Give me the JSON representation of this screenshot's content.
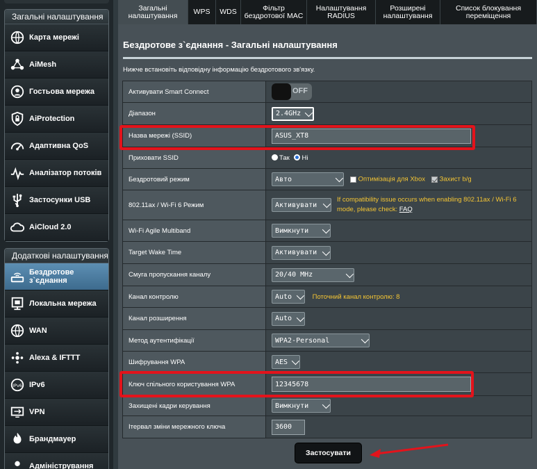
{
  "sidebar": {
    "general_title": "Загальні налаштування",
    "general_items": [
      {
        "label": "Карта мережі",
        "icon": "network-map-icon"
      },
      {
        "label": "AiMesh",
        "icon": "aimesh-icon"
      },
      {
        "label": "Гостьова мережа",
        "icon": "guest-network-icon"
      },
      {
        "label": "AiProtection",
        "icon": "shield-lock-icon"
      },
      {
        "label": "Адаптивна QoS",
        "icon": "qos-gauge-icon"
      },
      {
        "label": "Аналізатор потоків",
        "icon": "traffic-analyzer-icon"
      },
      {
        "label": "Застосунки USB",
        "icon": "usb-icon"
      },
      {
        "label": "AiCloud 2.0",
        "icon": "cloud-icon"
      }
    ],
    "advanced_title": "Додаткові налаштування",
    "advanced_items": [
      {
        "label": "Бездротове з`єднання",
        "icon": "wireless-icon"
      },
      {
        "label": "Локальна мережа",
        "icon": "lan-icon"
      },
      {
        "label": "WAN",
        "icon": "globe-icon"
      },
      {
        "label": "Alexa & IFTTT",
        "icon": "alexa-ifttt-icon"
      },
      {
        "label": "IPv6",
        "icon": "ipv6-icon"
      },
      {
        "label": "VPN",
        "icon": "vpn-icon"
      },
      {
        "label": "Брандмауер",
        "icon": "firewall-icon"
      },
      {
        "label": "Адміністрування",
        "icon": "admin-icon"
      }
    ]
  },
  "tabs": [
    {
      "label": "Загальні налаштування"
    },
    {
      "label": "WPS"
    },
    {
      "label": "WDS"
    },
    {
      "label": "Фільтр бездротової MAC"
    },
    {
      "label": "Налаштування RADIUS"
    },
    {
      "label": "Розширені налаштування"
    },
    {
      "label": "Список блокування переміщення"
    }
  ],
  "page": {
    "title": "Бездротове з`єднання - Загальні налаштування",
    "description": "Нижче встановіть відповідну інформацію бездротового зв'язку."
  },
  "settings": {
    "smart_connect": {
      "label": "Активувати Smart Connect",
      "state": "OFF"
    },
    "band": {
      "label": "Діапазон",
      "value": "2.4GHz"
    },
    "ssid": {
      "label": "Назва мережі (SSID)",
      "value": "ASUS_XT8"
    },
    "hide_ssid": {
      "label": "Приховати SSID",
      "yes": "Так",
      "no": "Ні"
    },
    "wireless_mode": {
      "label": "Бездротовий режим",
      "value": "Авто",
      "xbox_opt": "Оптимізація для Xbox",
      "bg_protect": "Захист b/g"
    },
    "ax_mode": {
      "label": "802.11ax / Wi-Fi 6 Режим",
      "value": "Активувати",
      "note": "If compatibility issue occurs when enabling 802.11ax / Wi-Fi 6 mode, please check:",
      "faq": "FAQ"
    },
    "agile_multiband": {
      "label": "Wi-Fi Agile Multiband",
      "value": "Вимкнути"
    },
    "target_wake_time": {
      "label": "Target Wake Time",
      "value": "Активувати"
    },
    "bandwidth": {
      "label": "Смуга пропускання каналу",
      "value": "20/40 MHz"
    },
    "control_channel": {
      "label": "Канал контролю",
      "value": "Auto",
      "note": "Поточний канал контролю: 8"
    },
    "extension_channel": {
      "label": "Канал розширення",
      "value": "Auto"
    },
    "auth_method": {
      "label": "Метод аутентифікації",
      "value": "WPA2-Personal"
    },
    "encryption": {
      "label": "Шифрування WPA",
      "value": "AES"
    },
    "wpa_key": {
      "label": "Ключ спільного користування WPA",
      "value": "12345678"
    },
    "pmf": {
      "label": "Захищені кадри керування",
      "value": "Вимкнути"
    },
    "key_rotation": {
      "label": "Ітервал зміни мережного ключа",
      "value": "3600"
    }
  },
  "apply_label": "Застосувати",
  "colors": {
    "highlight": "#e3131b",
    "note": "#f4c534",
    "active_nav": "#4d7ea3"
  }
}
